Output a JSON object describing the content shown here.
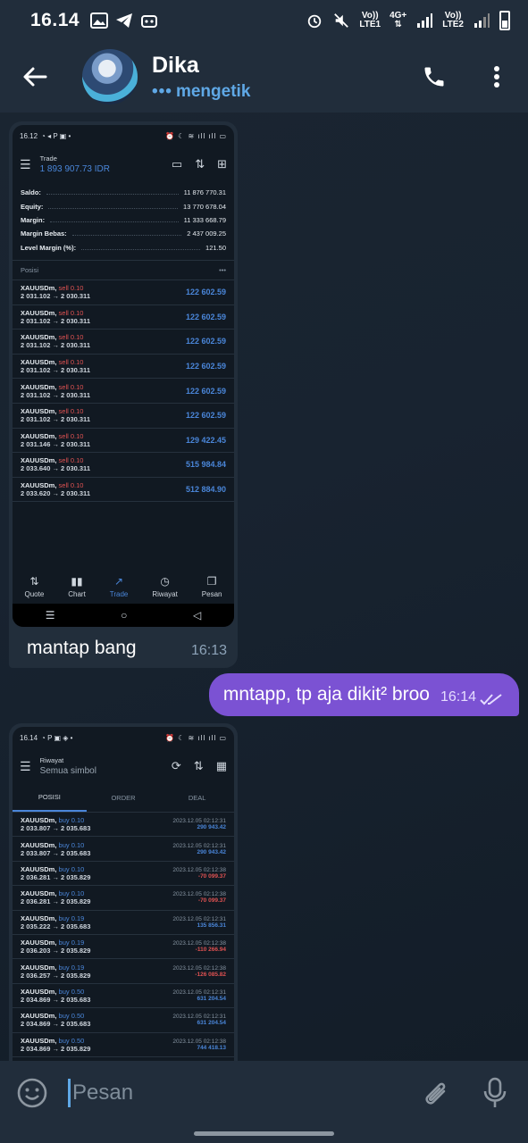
{
  "status_bar": {
    "time": "16.14",
    "net1_top": "Vo))",
    "net1_bottom": "LTE1",
    "net_type": "4G+",
    "net2_top": "Vo))",
    "net2_bottom": "LTE2"
  },
  "header": {
    "name": "Dika",
    "status": "mengetik",
    "typing_dots": "•••"
  },
  "messages": {
    "first_caption": "mantap bang",
    "first_time": "16:13",
    "reply_text": "mntapp, tp aja dikit² broo",
    "reply_time": "16:14"
  },
  "shot1": {
    "status_time": "16.12",
    "title": "Trade",
    "balance": "1 893 907.73 IDR",
    "account": [
      {
        "label": "Saldo:",
        "value": "11 876 770.31"
      },
      {
        "label": "Equity:",
        "value": "13 770 678.04"
      },
      {
        "label": "Margin:",
        "value": "11 333 668.79"
      },
      {
        "label": "Margin Bebas:",
        "value": "2 437 009.25"
      },
      {
        "label": "Level Margin (%):",
        "value": "121.50"
      }
    ],
    "section_title": "Posisi",
    "section_more": "•••",
    "positions": [
      {
        "symbol": "XAUUSDm,",
        "side": "sell 0.10",
        "prices": "2 031.102 → 2 030.311",
        "profit": "122 602.59"
      },
      {
        "symbol": "XAUUSDm,",
        "side": "sell 0.10",
        "prices": "2 031.102 → 2 030.311",
        "profit": "122 602.59"
      },
      {
        "symbol": "XAUUSDm,",
        "side": "sell 0.10",
        "prices": "2 031.102 → 2 030.311",
        "profit": "122 602.59"
      },
      {
        "symbol": "XAUUSDm,",
        "side": "sell 0.10",
        "prices": "2 031.102 → 2 030.311",
        "profit": "122 602.59"
      },
      {
        "symbol": "XAUUSDm,",
        "side": "sell 0.10",
        "prices": "2 031.102 → 2 030.311",
        "profit": "122 602.59"
      },
      {
        "symbol": "XAUUSDm,",
        "side": "sell 0.10",
        "prices": "2 031.102 → 2 030.311",
        "profit": "122 602.59"
      },
      {
        "symbol": "XAUUSDm,",
        "side": "sell 0.10",
        "prices": "2 031.146 → 2 030.311",
        "profit": "129 422.45"
      },
      {
        "symbol": "XAUUSDm,",
        "side": "sell 0.10",
        "prices": "2 033.640 → 2 030.311",
        "profit": "515 984.84"
      },
      {
        "symbol": "XAUUSDm,",
        "side": "sell 0.10",
        "prices": "2 033.620 → 2 030.311",
        "profit": "512 884.90"
      }
    ],
    "nav": [
      {
        "label": "Quote",
        "icon": "⇅"
      },
      {
        "label": "Chart",
        "icon": "▮▮"
      },
      {
        "label": "Trade",
        "icon": "↗"
      },
      {
        "label": "Riwayat",
        "icon": "◷"
      },
      {
        "label": "Pesan",
        "icon": "❐"
      }
    ]
  },
  "shot2": {
    "status_time": "16.14",
    "title": "Riwayat",
    "subtitle": "Semua simbol",
    "tabs": [
      "POSISI",
      "ORDER",
      "DEAL"
    ],
    "history": [
      {
        "symbol": "XAUUSDm,",
        "side": "buy 0.10",
        "prices": "2 033.807 → 2 035.683",
        "date": "2023.12.05 02:12:31",
        "profit": "290 943.42",
        "sign": "pos"
      },
      {
        "symbol": "XAUUSDm,",
        "side": "buy 0.10",
        "prices": "2 033.807 → 2 035.683",
        "date": "2023.12.05 02:12:31",
        "profit": "290 943.42",
        "sign": "pos"
      },
      {
        "symbol": "XAUUSDm,",
        "side": "buy 0.10",
        "prices": "2 036.281 → 2 035.829",
        "date": "2023.12.05 02:12:38",
        "profit": "-70 099.37",
        "sign": "neg"
      },
      {
        "symbol": "XAUUSDm,",
        "side": "buy 0.10",
        "prices": "2 036.281 → 2 035.829",
        "date": "2023.12.05 02:12:38",
        "profit": "-70 099.37",
        "sign": "neg"
      },
      {
        "symbol": "XAUUSDm,",
        "side": "buy 0.19",
        "prices": "2 035.222 → 2 035.683",
        "date": "2023.12.05 02:12:31",
        "profit": "135 856.31",
        "sign": "pos"
      },
      {
        "symbol": "XAUUSDm,",
        "side": "buy 0.19",
        "prices": "2 036.203 → 2 035.829",
        "date": "2023.12.05 02:12:38",
        "profit": "-110 266.94",
        "sign": "neg"
      },
      {
        "symbol": "XAUUSDm,",
        "side": "buy 0.19",
        "prices": "2 036.257 → 2 035.829",
        "date": "2023.12.05 02:12:38",
        "profit": "-126 085.82",
        "sign": "neg"
      },
      {
        "symbol": "XAUUSDm,",
        "side": "buy 0.50",
        "prices": "2 034.869 → 2 035.683",
        "date": "2023.12.05 02:12:31",
        "profit": "631 204.54",
        "sign": "pos"
      },
      {
        "symbol": "XAUUSDm,",
        "side": "buy 0.50",
        "prices": "2 034.869 → 2 035.683",
        "date": "2023.12.05 02:12:31",
        "profit": "631 204.54",
        "sign": "pos"
      },
      {
        "symbol": "XAUUSDm,",
        "side": "buy 0.50",
        "prices": "2 034.869 → 2 035.829",
        "date": "2023.12.05 02:12:38",
        "profit": "744 418.13",
        "sign": "pos"
      }
    ]
  },
  "composer": {
    "placeholder": "Pesan"
  },
  "colors": {
    "accent": "#5fa8e6",
    "outgoing_bubble": "#7b52d3",
    "profit_positive": "#4a86d9",
    "profit_negative": "#e05252"
  }
}
